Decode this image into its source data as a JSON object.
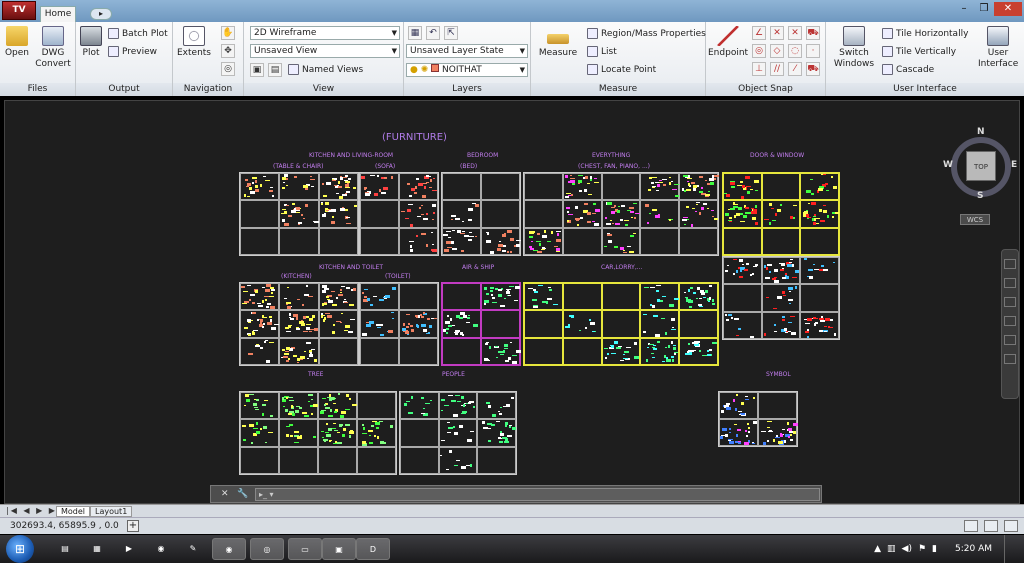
{
  "app": {
    "menu_label": "TV",
    "tab_home": "Home",
    "tab_extra": "▸"
  },
  "window_controls": {
    "minimize": "–",
    "restore": "❒",
    "close": "✕"
  },
  "ribbon": {
    "files": {
      "title": "Files",
      "open": "Open",
      "dwg_convert_1": "DWG",
      "dwg_convert_2": "Convert"
    },
    "output": {
      "title": "Output",
      "plot": "Plot",
      "batch_plot": "Batch Plot",
      "preview": "Preview"
    },
    "navigation": {
      "title": "Navigation",
      "extents": "Extents"
    },
    "view": {
      "title": "View",
      "visual_style": "2D Wireframe",
      "saved_view": "Unsaved View",
      "named_views": "Named Views"
    },
    "layers": {
      "title": "Layers",
      "layer_state": "Unsaved Layer State",
      "current_layer": "NOITHAT"
    },
    "measure": {
      "title": "Measure",
      "measure": "Measure",
      "region": "Region/Mass Properties",
      "list": "List",
      "locate": "Locate Point"
    },
    "osnap": {
      "title": "Object Snap",
      "endpoint": "Endpoint"
    },
    "ui": {
      "title": "User Interface",
      "switch_1": "Switch",
      "switch_2": "Windows",
      "tile_h": "Tile Horizontally",
      "tile_v": "Tile Vertically",
      "cascade": "Cascade",
      "user_1": "User",
      "user_2": "Interface"
    }
  },
  "drawing": {
    "sheet_title": "(FURNITURE)",
    "labels": {
      "kitchen_living": "KITCHEN AND LIVING-ROOM",
      "table_chair": "(TABLE & CHAIR)",
      "sofa": "(SOFA)",
      "bedroom": "BEDROOM",
      "bed": "(BED)",
      "everything": "EVERYTHING",
      "chest": "(CHEST, FAN, PIANO, ...)",
      "door_window": "DOOR & WINDOW",
      "kitchen_toilet": "KITCHEN AND TOILET",
      "kitchen": "(KITCHEN)",
      "toilet": "(TOILET)",
      "air_ship": "AIR & SHIP",
      "car_lorry": "CAR,LORRY,...",
      "tree": "TREE",
      "people": "PEOPLE",
      "symbol": "SYMBOL"
    },
    "viewcube": {
      "top": "TOP",
      "n": "N",
      "s": "S",
      "e": "E",
      "w": "W",
      "wcs": "WCS"
    },
    "colors": {
      "background": "#1e1e1e",
      "label": "#c37ef0",
      "grid": "#cccccc"
    }
  },
  "command_line": {
    "placeholder": "▸_ ▾"
  },
  "layout_tabs": {
    "nav": "|◀ ◀ ▶ ▶|",
    "model": "Model",
    "layout1": "Layout1"
  },
  "status": {
    "coordinates": "302693.4, 65895.9 , 0.0"
  },
  "taskbar": {
    "clock": "5:20 AM",
    "start": "⊞"
  }
}
